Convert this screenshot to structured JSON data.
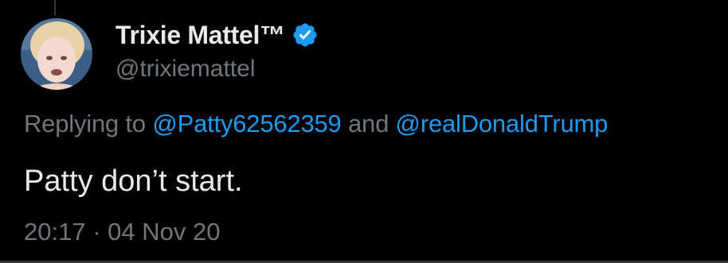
{
  "tweet": {
    "author": {
      "display_name": "Trixie Mattel™",
      "handle": "@trixiemattel",
      "verified": true,
      "avatar_icon": "profile-photo"
    },
    "reply": {
      "prefix": "Replying to",
      "mention_1": "@Patty62562359",
      "conjunction": "and",
      "mention_2": "@realDonaldTrump"
    },
    "text": "Patty don’t start.",
    "timestamp": {
      "time": "20:17",
      "separator": "·",
      "date": "04 Nov 20"
    }
  },
  "colors": {
    "background": "#000000",
    "primary_text": "#e7e9ea",
    "secondary_text": "#71767b",
    "link": "#1d9bf0",
    "verified_badge": "#1d9bf0"
  }
}
